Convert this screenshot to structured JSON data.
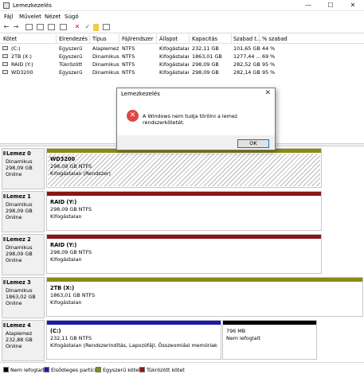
{
  "window": {
    "title": "Lemezkezelés",
    "min": "—",
    "max": "☐",
    "close": "✕"
  },
  "menu": [
    "Fájl",
    "Művelet",
    "Nézet",
    "Súgó"
  ],
  "table": {
    "headers": [
      "Kötet",
      "Elrendezés",
      "Típus",
      "Fájlrendszer",
      "Állapot",
      "Kapacitás",
      "Szabad t...",
      "% szabad"
    ],
    "rows": [
      [
        "(C:)",
        "Egyszerű",
        "Alaplemez",
        "NTFS",
        "Kifogástalan (R...",
        "232,11 GB",
        "101,65 GB",
        "44 %"
      ],
      [
        "2TB (X:)",
        "Egyszerű",
        "Dinamikus",
        "NTFS",
        "Kifogástalan",
        "1863,01 GB",
        "1277,44 ...",
        "69 %"
      ],
      [
        "RAID (Y:)",
        "Tükrözött",
        "Dinamikus",
        "NTFS",
        "Kifogástalan",
        "298,09 GB",
        "282,52 GB",
        "95 %"
      ],
      [
        "WD3200",
        "Egyszerű",
        "Dinamikus",
        "NTFS",
        "Kifogástalan (R...",
        "298,09 GB",
        "282,14 GB",
        "95 %"
      ]
    ]
  },
  "disks": [
    {
      "name": "Lemez 0",
      "type": "Dinamikus",
      "size": "298,09 GB",
      "status": "Online",
      "volumes": [
        {
          "name": "WD3200",
          "size": "298,09 GB NTFS",
          "status": "Kifogástalan (Rendszer)"
        }
      ]
    },
    {
      "name": "Lemez 1",
      "type": "Dinamikus",
      "size": "298,09 GB",
      "status": "Online",
      "volumes": [
        {
          "name": "RAID (Y:)",
          "size": "298,09 GB NTFS",
          "status": "Kifogástalan"
        }
      ]
    },
    {
      "name": "Lemez 2",
      "type": "Dinamikus",
      "size": "298,09 GB",
      "status": "Online",
      "volumes": [
        {
          "name": "RAID (Y:)",
          "size": "298,09 GB NTFS",
          "status": "Kifogástalan"
        }
      ]
    },
    {
      "name": "Lemez 3",
      "type": "Dinamikus",
      "size": "1863,02 GB",
      "status": "Online",
      "volumes": [
        {
          "name": "2TB (X:)",
          "size": "1863,01 GB NTFS",
          "status": "Kifogástalan"
        }
      ]
    },
    {
      "name": "Lemez 4",
      "type": "Alaplemez",
      "size": "232,88 GB",
      "status": "Online",
      "volumes": [
        {
          "name": "(C:)",
          "size": "232,11 GB NTFS",
          "status": "Kifogástalan (Rendszerindítás, Lapozófájl, Összeomlási memóriakép, Elsődl"
        },
        {
          "name": "",
          "size": "796 MB",
          "status": "Nem lefoglalt"
        }
      ]
    }
  ],
  "legend": [
    {
      "label": "Nem lefoglalt",
      "color": "#000000"
    },
    {
      "label": "Elsődleges partíció",
      "color": "#1a1aa8"
    },
    {
      "label": "Egyszerű kötet",
      "color": "#8a8a14"
    },
    {
      "label": "Tükrözött kötet",
      "color": "#8b1515"
    }
  ],
  "dialog": {
    "title": "Lemezkezelés",
    "message": "A Windows nem tudja törölni a lemez rendszerkötetét.",
    "ok": "OK"
  },
  "colors": {
    "simple": "#8a8a14",
    "mirrored": "#8b1515",
    "primary": "#1a1aa8",
    "unallocated": "#000000"
  }
}
